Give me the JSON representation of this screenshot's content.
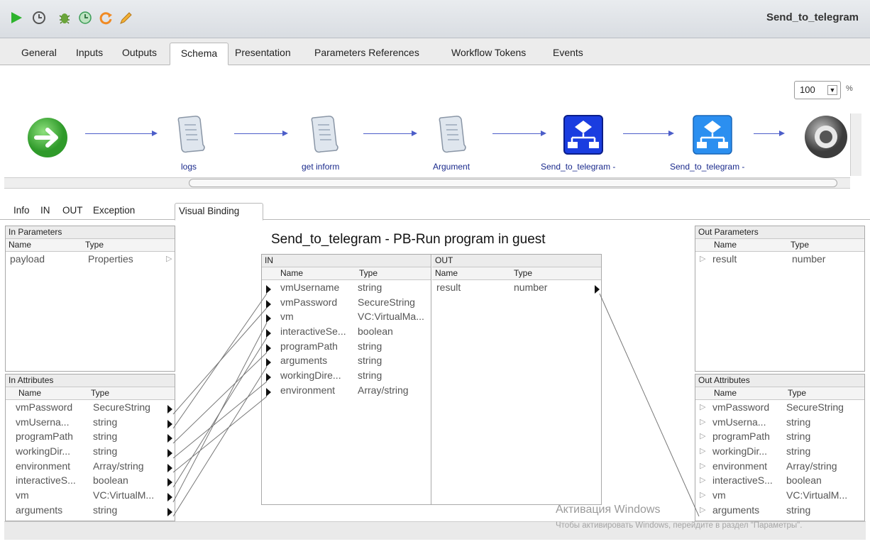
{
  "window": {
    "title": "Send_to_telegram"
  },
  "toolbar_icons": [
    "run-icon",
    "history-icon",
    "debug-icon",
    "schedule-icon",
    "refresh-icon",
    "edit-icon"
  ],
  "main_tabs": [
    "General",
    "Inputs",
    "Outputs",
    "Schema",
    "Presentation",
    "Parameters References",
    "Workflow Tokens",
    "Events"
  ],
  "active_main_tab": "Schema",
  "schema": {
    "zoom": "100",
    "zoom_unit": "%",
    "nodes": [
      {
        "type": "start",
        "label": ""
      },
      {
        "type": "script",
        "label": "logs"
      },
      {
        "type": "script",
        "label": "get inform"
      },
      {
        "type": "script",
        "label": "Argument"
      },
      {
        "type": "workflow-selected",
        "label": "Send_to_telegram -"
      },
      {
        "type": "workflow",
        "label": "Send_to_telegram -"
      },
      {
        "type": "end",
        "label": ""
      }
    ]
  },
  "sub_tabs": [
    "Info",
    "IN",
    "OUT",
    "Exception",
    "Visual Binding"
  ],
  "active_sub_tab": "Visual Binding",
  "binding": {
    "title": "Send_to_telegram - PB-Run program in guest",
    "in_parameters": {
      "title": "In Parameters",
      "headers": [
        "Name",
        "Type"
      ],
      "rows": [
        {
          "name": "payload",
          "type": "Properties"
        }
      ]
    },
    "in_attributes": {
      "title": "In Attributes",
      "headers": [
        "Name",
        "Type"
      ],
      "rows": [
        {
          "name": "vmPassword",
          "type": "SecureString"
        },
        {
          "name": "vmUserna...",
          "type": "string"
        },
        {
          "name": "programPath",
          "type": "string"
        },
        {
          "name": "workingDir...",
          "type": "string"
        },
        {
          "name": "environment",
          "type": "Array/string"
        },
        {
          "name": "interactiveS...",
          "type": "boolean"
        },
        {
          "name": "vm",
          "type": "VC:VirtualM..."
        },
        {
          "name": "arguments",
          "type": "string"
        }
      ]
    },
    "center_in": {
      "title": "IN",
      "headers": [
        "Name",
        "Type"
      ],
      "rows": [
        {
          "name": "vmUsername",
          "type": "string"
        },
        {
          "name": "vmPassword",
          "type": "SecureString"
        },
        {
          "name": "vm",
          "type": "VC:VirtualMa..."
        },
        {
          "name": "interactiveSe...",
          "type": "boolean"
        },
        {
          "name": "programPath",
          "type": "string"
        },
        {
          "name": "arguments",
          "type": "string"
        },
        {
          "name": "workingDire...",
          "type": "string"
        },
        {
          "name": "environment",
          "type": "Array/string"
        }
      ]
    },
    "center_out": {
      "title": "OUT",
      "headers": [
        "Name",
        "Type"
      ],
      "rows": [
        {
          "name": "result",
          "type": "number"
        }
      ]
    },
    "out_parameters": {
      "title": "Out Parameters",
      "headers": [
        "Name",
        "Type"
      ],
      "rows": [
        {
          "name": "result",
          "type": "number"
        }
      ]
    },
    "out_attributes": {
      "title": "Out Attributes",
      "headers": [
        "Name",
        "Type"
      ],
      "rows": [
        {
          "name": "vmPassword",
          "type": "SecureString"
        },
        {
          "name": "vmUserna...",
          "type": "string"
        },
        {
          "name": "programPath",
          "type": "string"
        },
        {
          "name": "workingDir...",
          "type": "string"
        },
        {
          "name": "environment",
          "type": "Array/string"
        },
        {
          "name": "interactiveS...",
          "type": "boolean"
        },
        {
          "name": "vm",
          "type": "VC:VirtualM..."
        },
        {
          "name": "arguments",
          "type": "string"
        }
      ]
    }
  },
  "watermark": {
    "line1": "Активация Windows",
    "line2": "Чтобы активировать Windows, перейдите в раздел \"Параметры\"."
  }
}
